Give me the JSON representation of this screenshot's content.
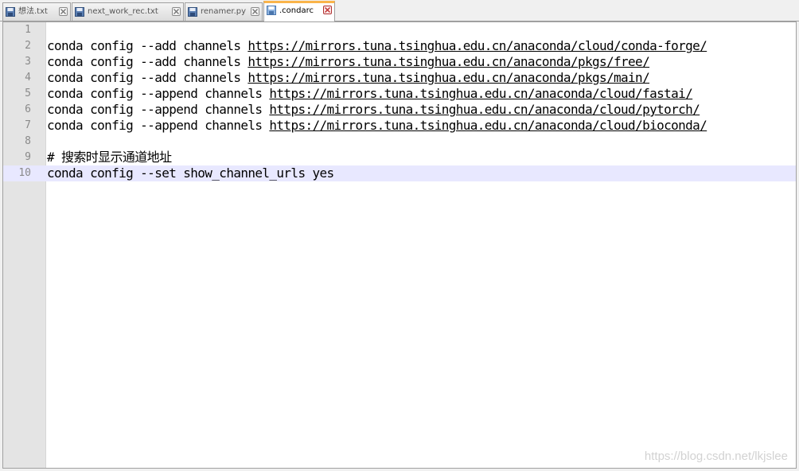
{
  "tabs": [
    {
      "label": "想法.txt",
      "active": false
    },
    {
      "label": "next_work_rec.txt",
      "active": false
    },
    {
      "label": "renamer.py",
      "active": false
    },
    {
      "label": ".condarc",
      "active": true
    }
  ],
  "editor": {
    "current_line": 10,
    "lines": [
      {
        "num": "1",
        "cmd": "",
        "url": ""
      },
      {
        "num": "2",
        "cmd": "conda config --add channels ",
        "url": "https://mirrors.tuna.tsinghua.edu.cn/anaconda/cloud/conda-forge/"
      },
      {
        "num": "3",
        "cmd": "conda config --add channels ",
        "url": "https://mirrors.tuna.tsinghua.edu.cn/anaconda/pkgs/free/"
      },
      {
        "num": "4",
        "cmd": "conda config --add channels ",
        "url": "https://mirrors.tuna.tsinghua.edu.cn/anaconda/pkgs/main/"
      },
      {
        "num": "5",
        "cmd": "conda config --append channels ",
        "url": "https://mirrors.tuna.tsinghua.edu.cn/anaconda/cloud/fastai/"
      },
      {
        "num": "6",
        "cmd": "conda config --append channels ",
        "url": "https://mirrors.tuna.tsinghua.edu.cn/anaconda/cloud/pytorch/"
      },
      {
        "num": "7",
        "cmd": "conda config --append channels ",
        "url": "https://mirrors.tuna.tsinghua.edu.cn/anaconda/cloud/bioconda/"
      },
      {
        "num": "8",
        "cmd": "",
        "url": ""
      },
      {
        "num": "9",
        "cmd": "# 搜索时显示通道地址",
        "url": ""
      },
      {
        "num": "10",
        "cmd": "conda config --set show_channel_urls yes",
        "url": ""
      }
    ]
  },
  "watermark": "https://blog.csdn.net/lkjslee",
  "colors": {
    "active_tab_accent": "#fab44a",
    "current_line_bg": "#e8e8ff",
    "gutter_bg": "#e4e4e4",
    "save_icon": "#2f6fb5",
    "close_icon_active": "#c03030"
  }
}
